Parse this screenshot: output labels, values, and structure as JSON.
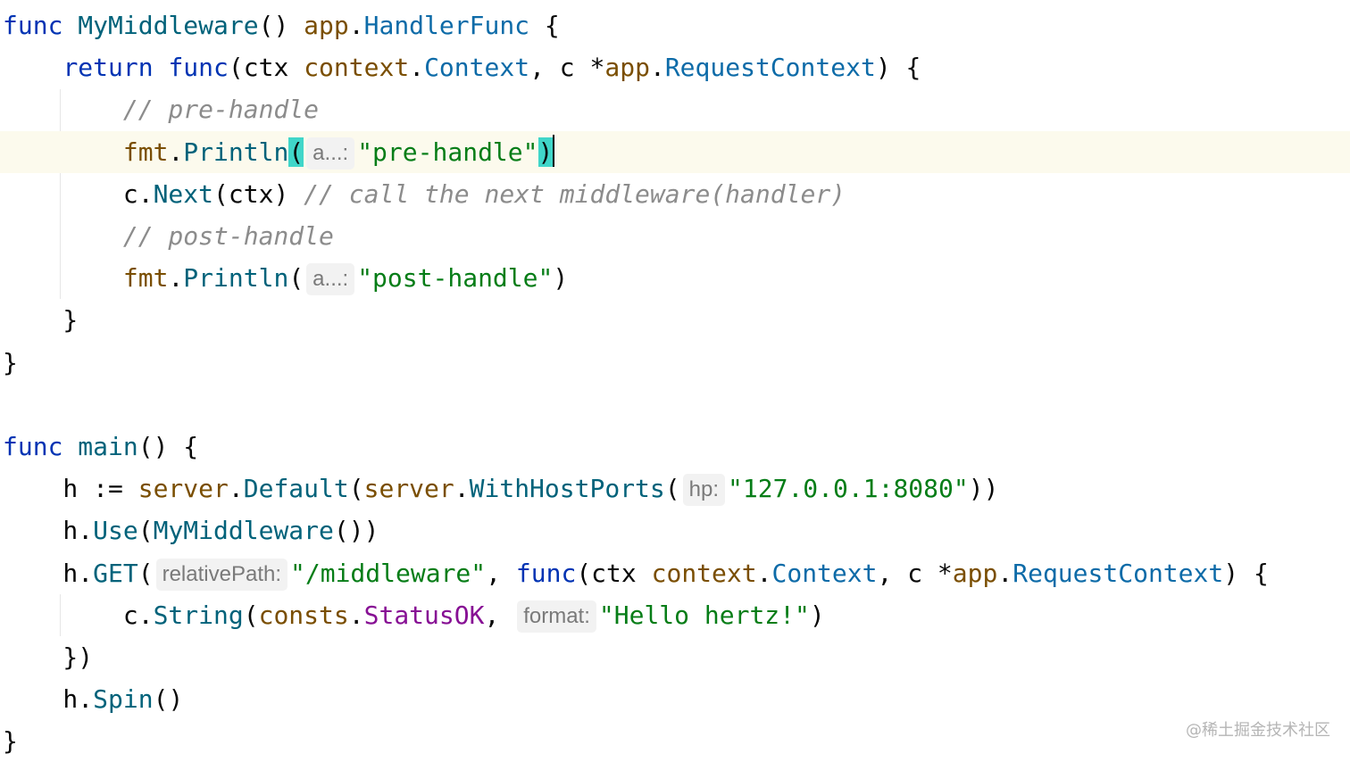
{
  "code": {
    "lines": [
      {
        "tokens": [
          {
            "t": "func",
            "c": "kw"
          },
          {
            "t": " "
          },
          {
            "t": "MyMiddleware",
            "c": "fn"
          },
          {
            "t": "() "
          },
          {
            "t": "app",
            "c": "pkg"
          },
          {
            "t": "."
          },
          {
            "t": "HandlerFunc",
            "c": "ty"
          },
          {
            "t": " {"
          }
        ]
      },
      {
        "tokens": [
          {
            "t": "    "
          },
          {
            "t": "return",
            "c": "kw"
          },
          {
            "t": " "
          },
          {
            "t": "func",
            "c": "kw"
          },
          {
            "t": "(ctx "
          },
          {
            "t": "context",
            "c": "pkg"
          },
          {
            "t": "."
          },
          {
            "t": "Context",
            "c": "ty"
          },
          {
            "t": ", c *"
          },
          {
            "t": "app",
            "c": "pkg"
          },
          {
            "t": "."
          },
          {
            "t": "RequestContext",
            "c": "ty"
          },
          {
            "t": ") {"
          }
        ]
      },
      {
        "tokens": [
          {
            "t": "        "
          },
          {
            "t": "// pre-handle",
            "c": "cmt"
          }
        ]
      },
      {
        "current": true,
        "tokens": [
          {
            "t": "        "
          },
          {
            "t": "fmt",
            "c": "pkg"
          },
          {
            "t": "."
          },
          {
            "t": "Println",
            "c": "meth"
          },
          {
            "t": "(",
            "c": "brace-match"
          },
          {
            "hint": "a...:"
          },
          {
            "t": "\"pre-handle\"",
            "c": "str"
          },
          {
            "t": ")",
            "c": "brace-match"
          },
          {
            "caret": true
          }
        ]
      },
      {
        "tokens": [
          {
            "t": "        c."
          },
          {
            "t": "Next",
            "c": "meth"
          },
          {
            "t": "(ctx) "
          },
          {
            "t": "// call the next middleware(handler)",
            "c": "cmt"
          }
        ]
      },
      {
        "tokens": [
          {
            "t": "        "
          },
          {
            "t": "// post-handle",
            "c": "cmt"
          }
        ]
      },
      {
        "tokens": [
          {
            "t": "        "
          },
          {
            "t": "fmt",
            "c": "pkg"
          },
          {
            "t": "."
          },
          {
            "t": "Println",
            "c": "meth"
          },
          {
            "t": "("
          },
          {
            "hint": "a...:"
          },
          {
            "t": "\"post-handle\"",
            "c": "str"
          },
          {
            "t": ")"
          }
        ]
      },
      {
        "tokens": [
          {
            "t": "    }"
          }
        ]
      },
      {
        "tokens": [
          {
            "t": "}"
          }
        ]
      },
      {
        "tokens": []
      },
      {
        "tokens": [
          {
            "t": "func",
            "c": "kw"
          },
          {
            "t": " "
          },
          {
            "t": "main",
            "c": "fn"
          },
          {
            "t": "() {"
          }
        ]
      },
      {
        "tokens": [
          {
            "t": "    h := "
          },
          {
            "t": "server",
            "c": "pkg"
          },
          {
            "t": "."
          },
          {
            "t": "Default",
            "c": "meth"
          },
          {
            "t": "("
          },
          {
            "t": "server",
            "c": "pkg"
          },
          {
            "t": "."
          },
          {
            "t": "WithHostPorts",
            "c": "meth"
          },
          {
            "t": "("
          },
          {
            "hint": "hp:"
          },
          {
            "t": "\"127.0.0.1:8080\"",
            "c": "str"
          },
          {
            "t": "))"
          }
        ]
      },
      {
        "tokens": [
          {
            "t": "    h."
          },
          {
            "t": "Use",
            "c": "meth"
          },
          {
            "t": "("
          },
          {
            "t": "MyMiddleware",
            "c": "meth"
          },
          {
            "t": "())"
          }
        ]
      },
      {
        "tokens": [
          {
            "t": "    h."
          },
          {
            "t": "GET",
            "c": "meth"
          },
          {
            "t": "("
          },
          {
            "hint": "relativePath:"
          },
          {
            "t": "\"/middleware\"",
            "c": "str"
          },
          {
            "t": ", "
          },
          {
            "t": "func",
            "c": "kw"
          },
          {
            "t": "(ctx "
          },
          {
            "t": "context",
            "c": "pkg"
          },
          {
            "t": "."
          },
          {
            "t": "Context",
            "c": "ty"
          },
          {
            "t": ", c *"
          },
          {
            "t": "app",
            "c": "pkg"
          },
          {
            "t": "."
          },
          {
            "t": "RequestContext",
            "c": "ty"
          },
          {
            "t": ") {"
          }
        ]
      },
      {
        "tokens": [
          {
            "t": "        c."
          },
          {
            "t": "String",
            "c": "meth"
          },
          {
            "t": "("
          },
          {
            "t": "consts",
            "c": "pkg"
          },
          {
            "t": "."
          },
          {
            "t": "StatusOK",
            "c": "konst"
          },
          {
            "t": ", "
          },
          {
            "hint": "format:"
          },
          {
            "t": "\"Hello hertz!\"",
            "c": "str"
          },
          {
            "t": ")"
          }
        ]
      },
      {
        "tokens": [
          {
            "t": "    })"
          }
        ]
      },
      {
        "tokens": [
          {
            "t": "    h."
          },
          {
            "t": "Spin",
            "c": "meth"
          },
          {
            "t": "()"
          }
        ]
      },
      {
        "tokens": [
          {
            "t": "}"
          }
        ]
      }
    ]
  },
  "watermark": "@稀土掘金技术社区",
  "colors": {
    "keyword": "#0033b3",
    "function": "#00627a",
    "package": "#7a4e00",
    "type": "#0d6ba8",
    "string": "#067d17",
    "comment": "#8c8c8c",
    "constant": "#871094",
    "current_line": "#fcfaed",
    "brace_match": "#40d6c9"
  }
}
